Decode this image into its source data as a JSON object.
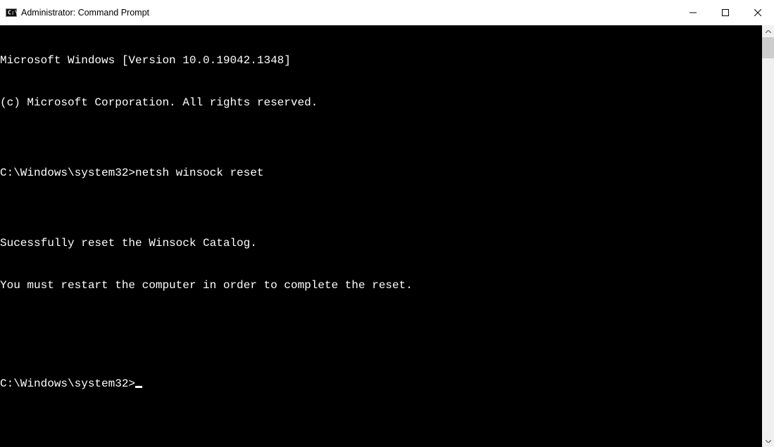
{
  "window": {
    "title": "Administrator: Command Prompt"
  },
  "terminal": {
    "lines": [
      "Microsoft Windows [Version 10.0.19042.1348]",
      "(c) Microsoft Corporation. All rights reserved.",
      "",
      "C:\\Windows\\system32>netsh winsock reset",
      "",
      "Sucessfully reset the Winsock Catalog.",
      "You must restart the computer in order to complete the reset.",
      "",
      ""
    ],
    "prompt": "C:\\Windows\\system32>"
  }
}
